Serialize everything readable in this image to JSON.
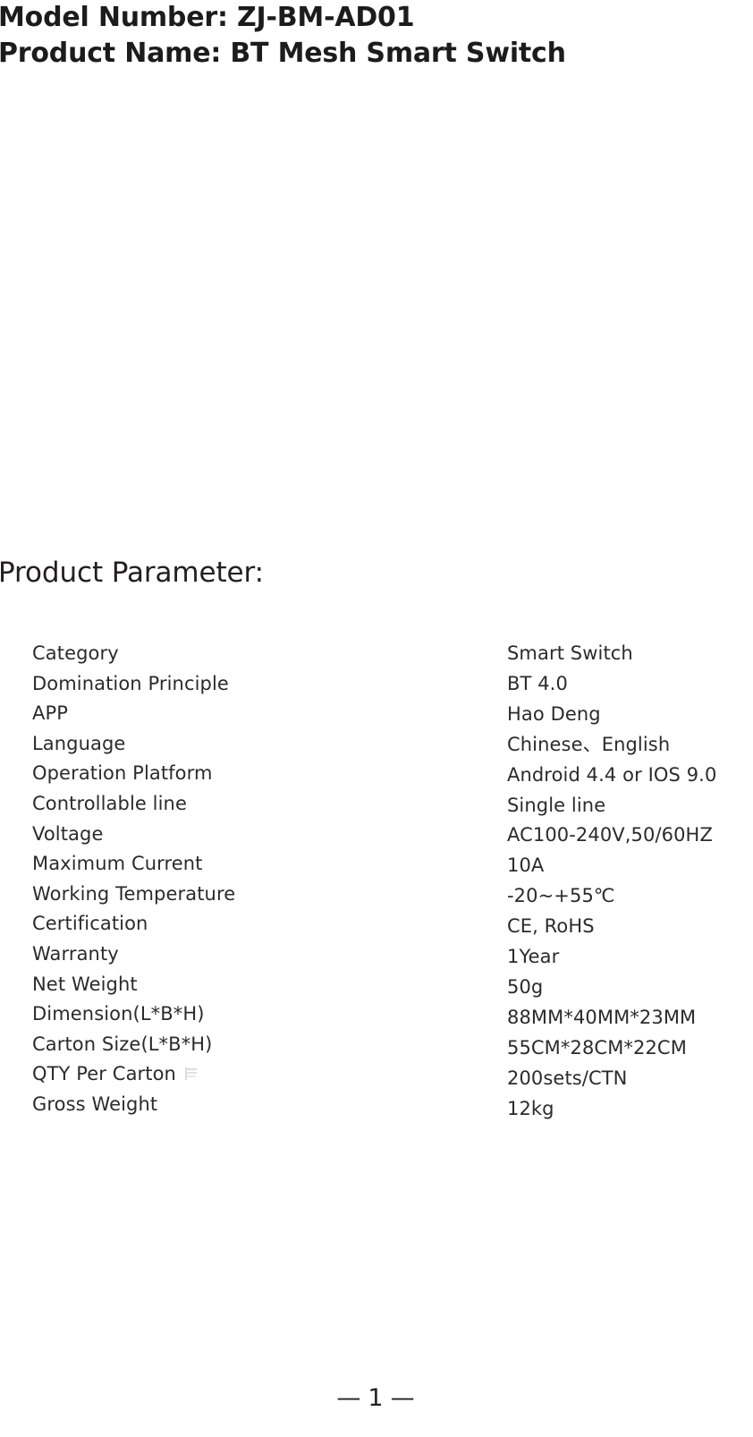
{
  "document": {
    "header": {
      "model_line": "Model Number: ZJ-BM-AD01",
      "product_line": "Product Name: BT Mesh Smart Switch"
    },
    "section_heading": "Product Parameter:",
    "parameters": [
      {
        "label": "Category",
        "value": "Smart Switch"
      },
      {
        "label": "Domination Principle",
        "value": "BT 4.0"
      },
      {
        "label": "APP",
        "value": "Hao Deng"
      },
      {
        "label": "Language",
        "value": "Chinese、English"
      },
      {
        "label": "Operation Platform",
        "value": "Android 4.4 or IOS 9.0"
      },
      {
        "label": "Controllable line",
        "value": "Single line"
      },
      {
        "label": "Voltage",
        "value": "AC100-240V,50/60HZ"
      },
      {
        "label": "Maximum Current",
        "value": "10A"
      },
      {
        "label": "Working Temperature",
        "value": "-20~+55℃"
      },
      {
        "label": "Certification",
        "value": "CE, RoHS"
      },
      {
        "label": "Warranty",
        "value": "1Year"
      },
      {
        "label": "Net Weight",
        "value": "50g"
      },
      {
        "label": "Dimension(L*B*H)",
        "value": "88MM*40MM*23MM"
      },
      {
        "label": "Carton Size(L*B*H)",
        "value": "55CM*28CM*22CM"
      },
      {
        "label": "QTY Per Carton",
        "value": "200sets/CTN"
      },
      {
        "label": "Gross Weight",
        "value": "12kg"
      }
    ],
    "footer": {
      "left_dash": "—",
      "page_number": "1",
      "right_dash": "—"
    },
    "colors": {
      "text": "#231f20",
      "heading": "#1c1c1c",
      "background": "#ffffff"
    }
  }
}
